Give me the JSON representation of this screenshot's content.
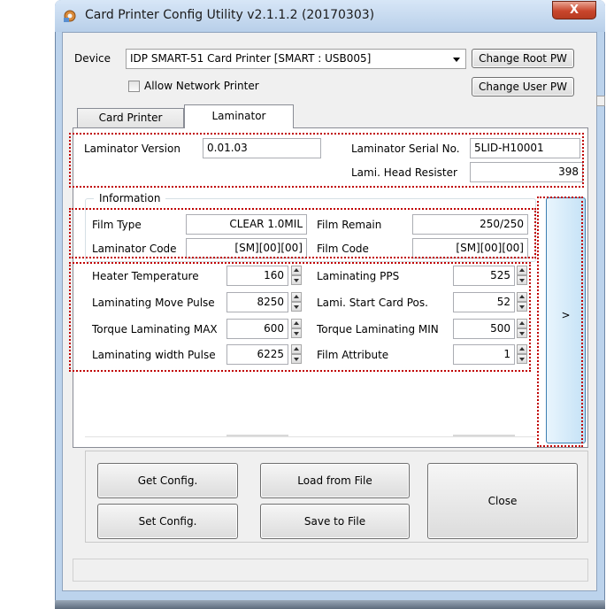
{
  "window": {
    "title": "Card Printer Config Utility v2.1.1.2 (20170303)",
    "close_label": "X"
  },
  "device": {
    "label": "Device",
    "selected": "IDP SMART-51 Card Printer  [SMART : USB005]",
    "change_root_pw": "Change Root PW",
    "change_user_pw": "Change User PW",
    "allow_network_label": "Allow Network Printer",
    "allow_network_checked": false
  },
  "tabs": [
    {
      "label": "Card Printer",
      "active": false
    },
    {
      "label": "Laminator",
      "active": true
    }
  ],
  "laminator": {
    "version_label": "Laminator Version",
    "version_value": "0.01.03",
    "serial_label": "Laminator Serial No.",
    "serial_value": "5LID-H10001",
    "head_resister_label": "Lami. Head Resister",
    "head_resister_value": "398"
  },
  "information": {
    "group_label": "Information",
    "film_type_label": "Film Type",
    "film_type_value": "CLEAR 1.0MIL",
    "film_remain_label": "Film Remain",
    "film_remain_value": "250/250",
    "laminator_code_label": "Laminator Code",
    "laminator_code_value": "[SM][00][00]",
    "film_code_label": "Film Code",
    "film_code_value": "[SM][00][00]"
  },
  "params": [
    {
      "label": "Heater Temperature",
      "value": "160"
    },
    {
      "label": "Laminating PPS",
      "value": "525"
    },
    {
      "label": "Laminating Move Pulse",
      "value": "8250"
    },
    {
      "label": "Lami. Start Card Pos.",
      "value": "52"
    },
    {
      "label": "Torque Laminating MAX",
      "value": "600"
    },
    {
      "label": "Torque Laminating MIN",
      "value": "500"
    },
    {
      "label": "Laminating width Pulse",
      "value": "6225"
    },
    {
      "label": "Film Attribute",
      "value": "1"
    }
  ],
  "nav_button_label": ">",
  "buttons": {
    "get_config": "Get Config.",
    "set_config": "Set Config.",
    "load_from_file": "Load from File",
    "save_to_file": "Save to File",
    "close": "Close"
  },
  "colors": {
    "highlight_outline": "#c00000",
    "nav_button_border": "#3c7fb1"
  }
}
